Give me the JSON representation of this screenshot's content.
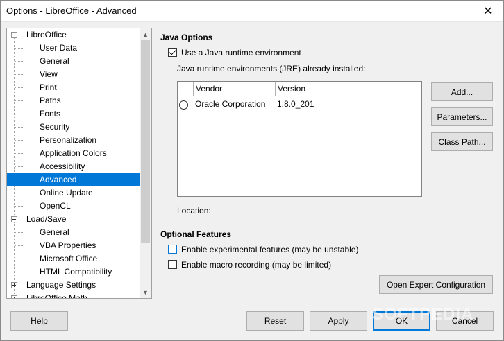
{
  "window": {
    "title": "Options - LibreOffice - Advanced",
    "close_glyph": "✕"
  },
  "tree": {
    "items": [
      {
        "label": "LibreOffice",
        "level": 0,
        "expander": "minus"
      },
      {
        "label": "User Data",
        "level": 1
      },
      {
        "label": "General",
        "level": 1
      },
      {
        "label": "View",
        "level": 1
      },
      {
        "label": "Print",
        "level": 1
      },
      {
        "label": "Paths",
        "level": 1
      },
      {
        "label": "Fonts",
        "level": 1
      },
      {
        "label": "Security",
        "level": 1
      },
      {
        "label": "Personalization",
        "level": 1
      },
      {
        "label": "Application Colors",
        "level": 1
      },
      {
        "label": "Accessibility",
        "level": 1
      },
      {
        "label": "Advanced",
        "level": 1,
        "selected": true
      },
      {
        "label": "Online Update",
        "level": 1
      },
      {
        "label": "OpenCL",
        "level": 1
      },
      {
        "label": "Load/Save",
        "level": 0,
        "expander": "minus"
      },
      {
        "label": "General",
        "level": 1
      },
      {
        "label": "VBA Properties",
        "level": 1
      },
      {
        "label": "Microsoft Office",
        "level": 1
      },
      {
        "label": "HTML Compatibility",
        "level": 1
      },
      {
        "label": "Language Settings",
        "level": 0,
        "expander": "plus"
      },
      {
        "label": "LibreOffice Math",
        "level": 0,
        "expander": "plus"
      }
    ]
  },
  "java": {
    "section_title": "Java Options",
    "use_jre_label": "Use a Java runtime environment",
    "use_jre_checked": true,
    "installed_label": "Java runtime environments (JRE) already installed:",
    "columns": [
      "Vendor",
      "Version"
    ],
    "rows": [
      {
        "vendor": "Oracle Corporation",
        "version": "1.8.0_201"
      }
    ],
    "location_label": "Location:",
    "add_button": "Add...",
    "parameters_button": "Parameters...",
    "classpath_button": "Class Path..."
  },
  "optional": {
    "section_title": "Optional Features",
    "experimental_label": "Enable experimental features (may be unstable)",
    "experimental_checked": false,
    "macro_label": "Enable macro recording (may be limited)",
    "macro_checked": false,
    "expert_button": "Open Expert Configuration"
  },
  "footer": {
    "help": "Help",
    "reset": "Reset",
    "apply": "Apply",
    "ok": "OK",
    "cancel": "Cancel"
  },
  "watermark": "SOFTPEDIA",
  "colors": {
    "selection": "#0078d7",
    "button_face": "#e1e1e1",
    "background": "#f0f0f0"
  }
}
